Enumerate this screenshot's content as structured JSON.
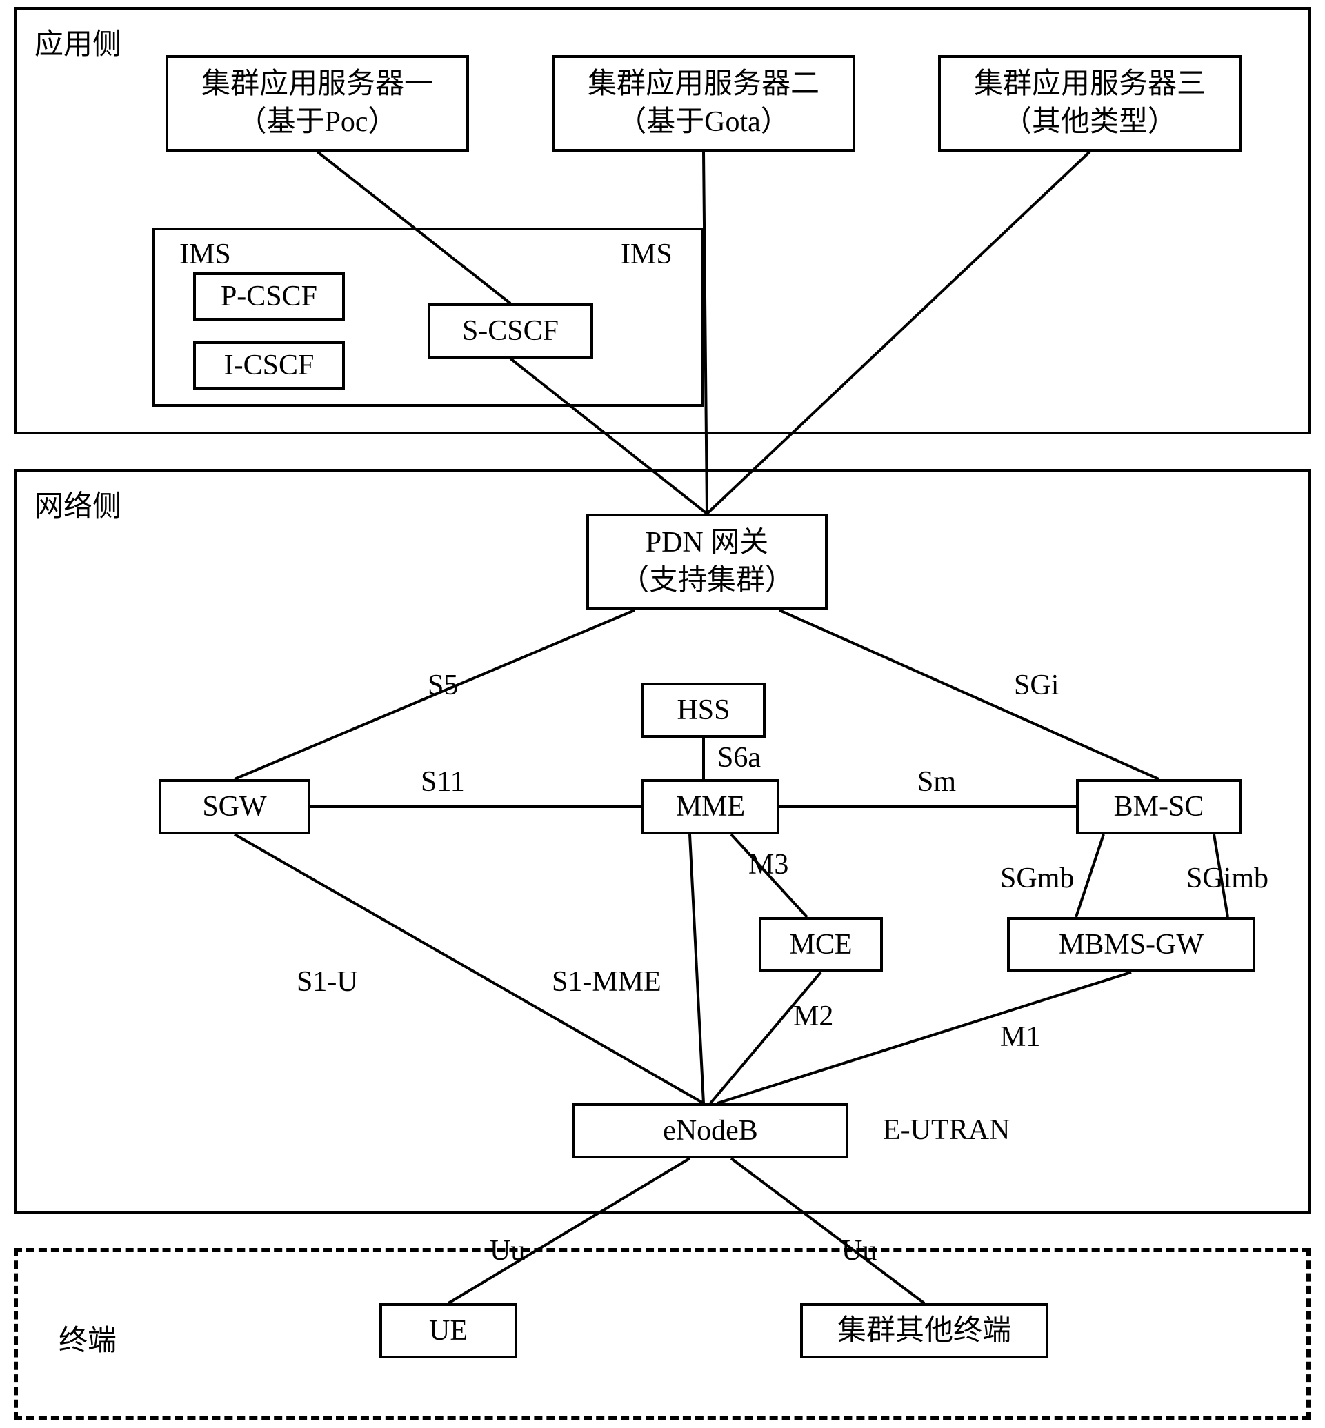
{
  "sections": {
    "app_side": "应用侧",
    "network_side": "网络侧",
    "terminal": "终端"
  },
  "nodes": {
    "server1_l1": "集群应用服务器一",
    "server1_l2": "（基于Poc）",
    "server2_l1": "集群应用服务器二",
    "server2_l2": "（基于Gota）",
    "server3_l1": "集群应用服务器三",
    "server3_l2": "（其他类型）",
    "ims_label1": "IMS",
    "ims_label2": "IMS",
    "p_cscf": "P-CSCF",
    "i_cscf": "I-CSCF",
    "s_cscf": "S-CSCF",
    "pdn_l1": "PDN 网关",
    "pdn_l2": "（支持集群）",
    "hss": "HSS",
    "sgw": "SGW",
    "mme": "MME",
    "bmsc": "BM-SC",
    "mce": "MCE",
    "mbmsgw": "MBMS-GW",
    "enodeb": "eNodeB",
    "eutran": "E-UTRAN",
    "ue": "UE",
    "other_terminal": "集群其他终端"
  },
  "edges": {
    "s5": "S5",
    "sgi": "SGi",
    "s6a": "S6a",
    "s11": "S11",
    "sm": "Sm",
    "m3": "M3",
    "sgmb": "SGmb",
    "sgimb": "SGimb",
    "s1u": "S1-U",
    "s1mme": "S1-MME",
    "m2": "M2",
    "m1": "M1",
    "uu1": "Uu",
    "uu2": "Uu"
  }
}
